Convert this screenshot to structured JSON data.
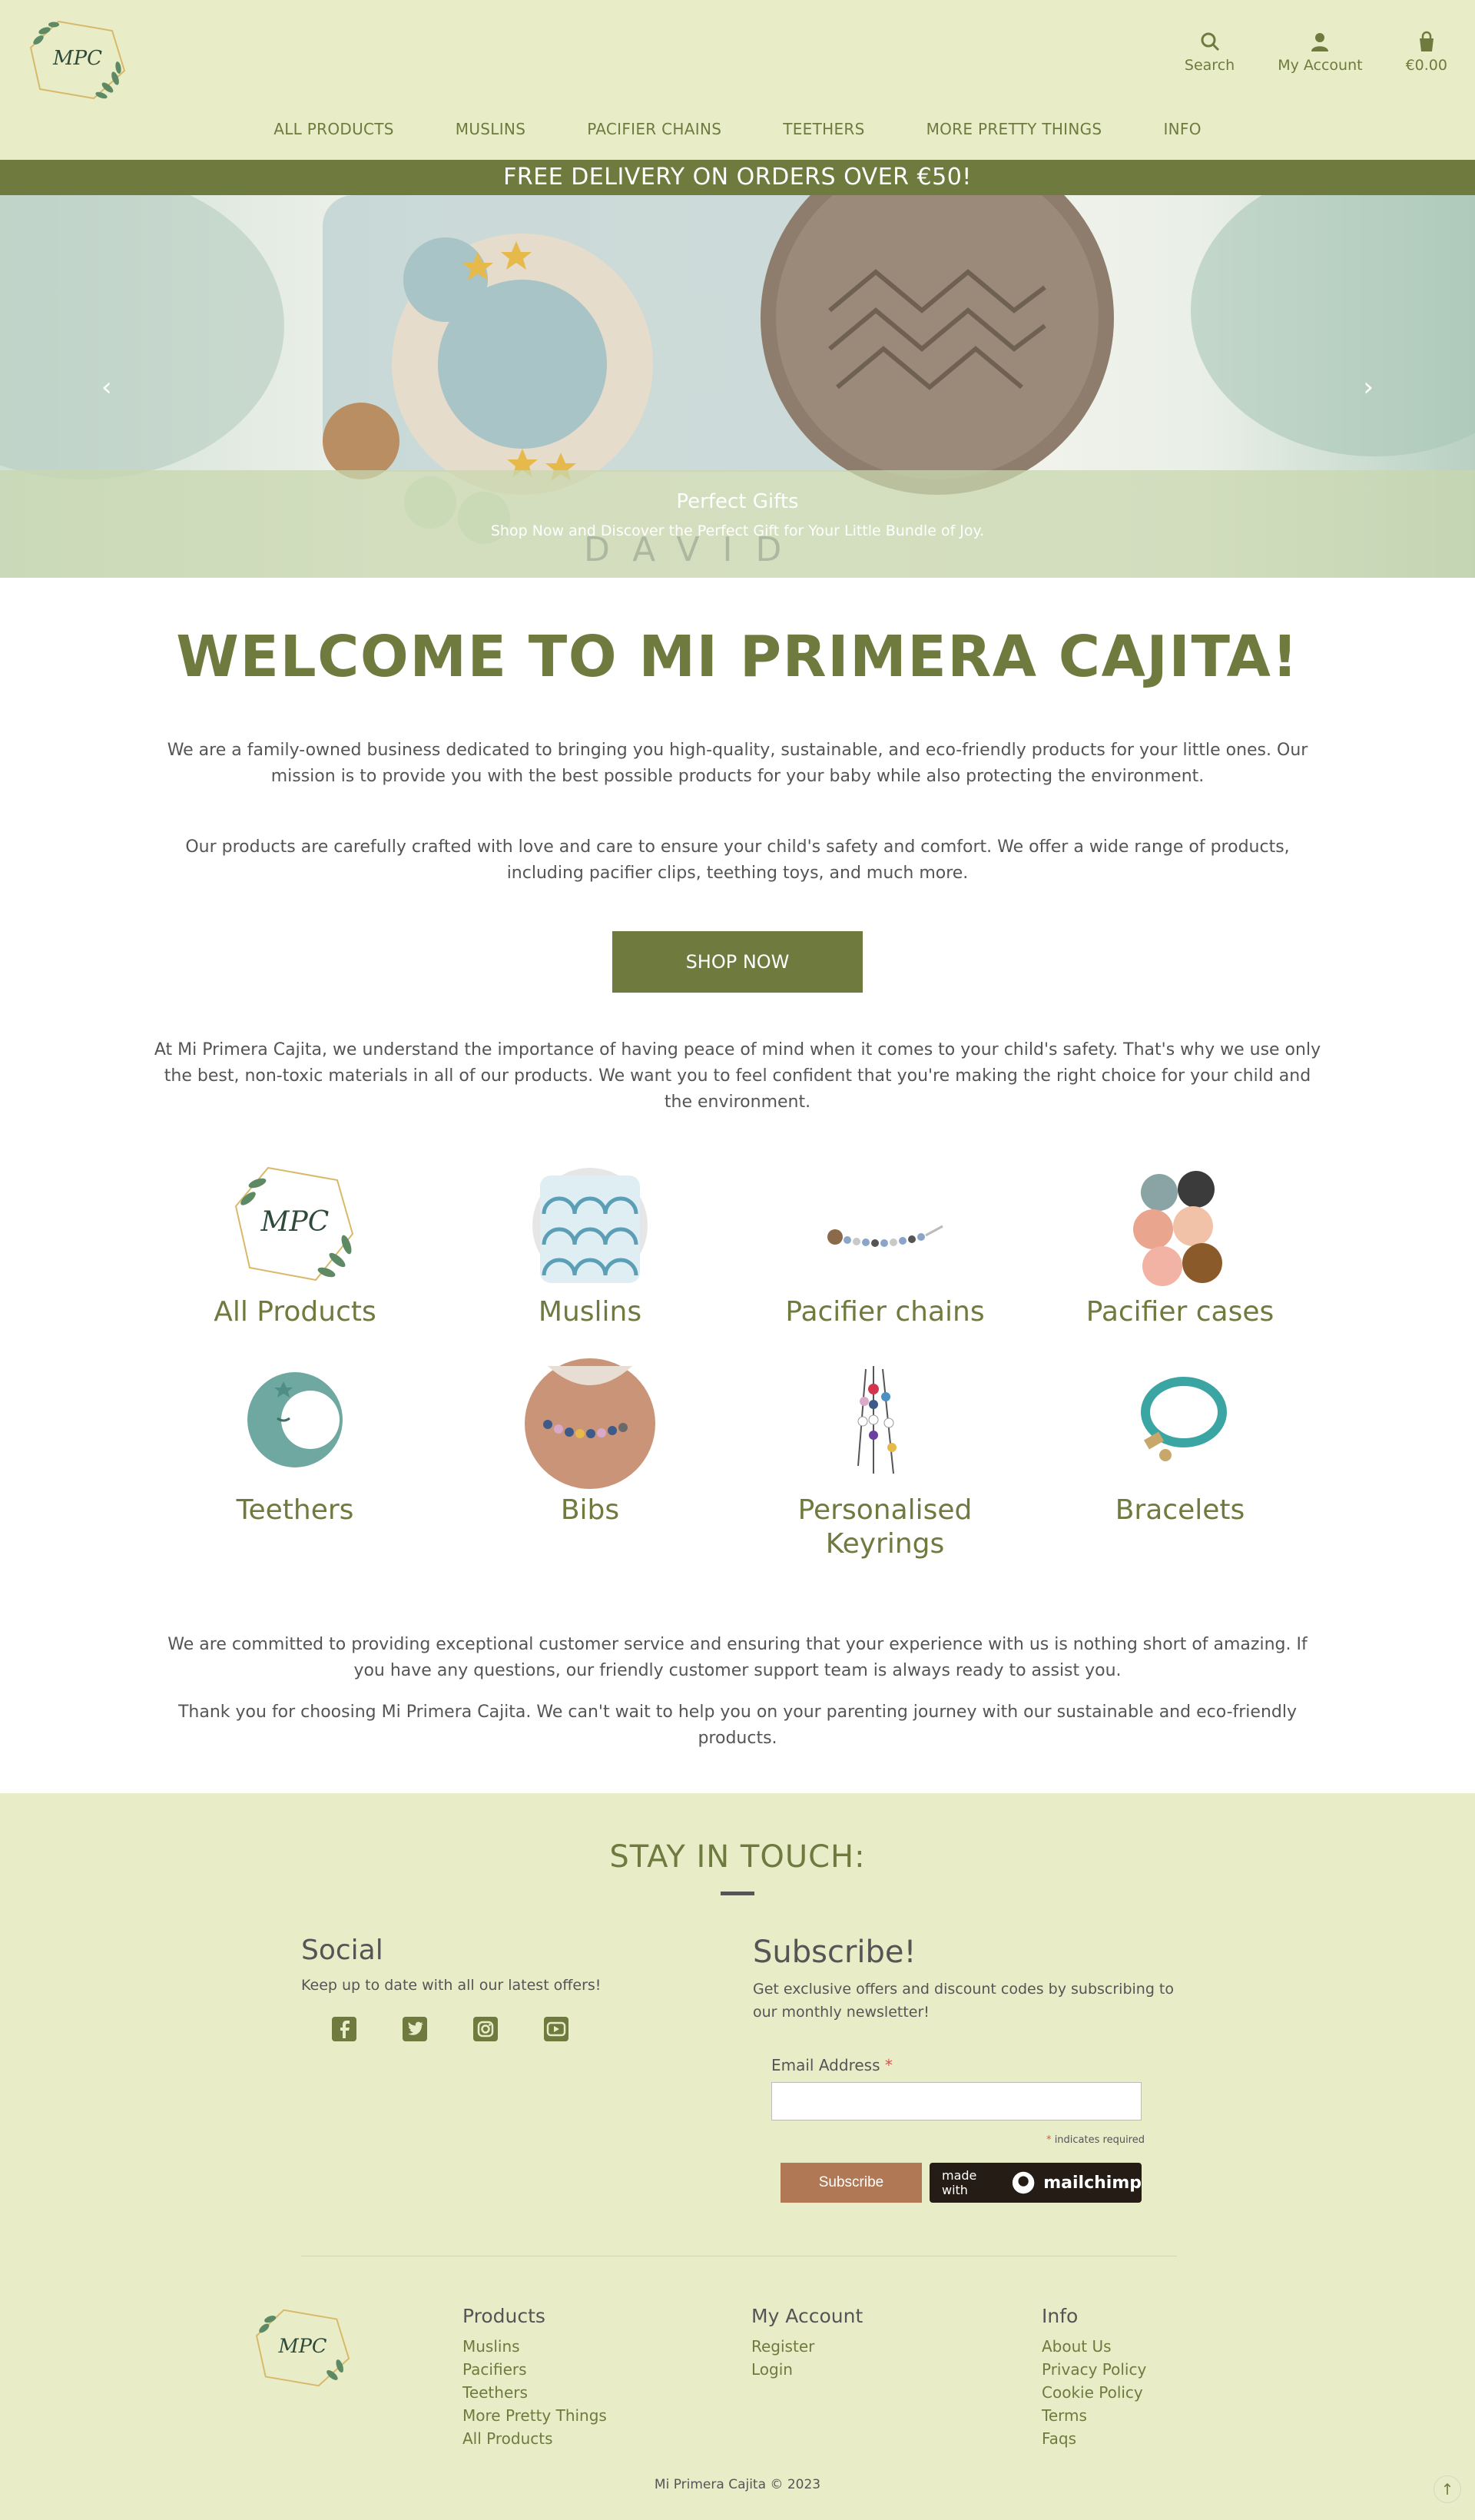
{
  "header": {
    "logo_monogram": "MPC",
    "tools": {
      "search": "Search",
      "account": "My Account",
      "cart": "€0.00"
    },
    "nav": [
      "ALL PRODUCTS",
      "MUSLINS",
      "PACIFIER CHAINS",
      "TEETHERS",
      "MORE PRETTY THINGS",
      "INFO"
    ]
  },
  "promo": "FREE DELIVERY ON ORDERS OVER €50!",
  "hero": {
    "title": "Perfect Gifts",
    "subtitle": "Shop Now and Discover the Perfect Gift for Your Little Bundle of Joy.",
    "name_beads": "DAVID"
  },
  "welcome": {
    "heading": "WELCOME TO MI PRIMERA CAJITA!",
    "p1": "We are a family-owned business dedicated to bringing you high-quality, sustainable, and eco-friendly products for your little ones. Our mission is to provide you with the best possible products for your baby while also protecting the environment.",
    "p2": "Our products are carefully crafted with love and care to ensure your child's safety and comfort. We offer a wide range of products, including pacifier clips, teething toys, and much more.",
    "shop_button": "SHOP NOW",
    "p3": "At Mi Primera Cajita, we understand the importance of having peace of mind when it comes to your child's safety. That's why we use only the best, non-toxic materials in all of our products. We want you to feel confident that you're making the right choice for your child and the environment."
  },
  "categories": [
    {
      "label": "All Products",
      "icon": "mpc-logo-icon"
    },
    {
      "label": "Muslins",
      "icon": "muslin-icon"
    },
    {
      "label": "Pacifier chains",
      "icon": "pacifier-chain-icon"
    },
    {
      "label": "Pacifier cases",
      "icon": "pacifier-case-icon"
    },
    {
      "label": "Teethers",
      "icon": "moon-teether-icon"
    },
    {
      "label": "Bibs",
      "icon": "bib-icon"
    },
    {
      "label": "Personalised Keyrings",
      "icon": "keyring-icon"
    },
    {
      "label": "Bracelets",
      "icon": "bracelet-icon"
    }
  ],
  "closing": {
    "p1": "We are committed to providing exceptional customer service and ensuring that your experience with us is nothing short of amazing. If you have any questions, our friendly customer support team is always ready to assist you.",
    "p2": "Thank you for choosing Mi Primera Cajita. We can't wait to help you on your parenting journey with our sustainable and eco-friendly products."
  },
  "footer": {
    "stay_heading": "STAY IN TOUCH:",
    "social": {
      "heading": "Social",
      "text": "Keep up to date with all our latest offers!",
      "icons": [
        "facebook-icon",
        "twitter-icon",
        "instagram-icon",
        "youtube-icon"
      ]
    },
    "subscribe": {
      "heading": "Subscribe!",
      "text": "Get exclusive offers and discount codes by subscribing to our monthly newsletter!",
      "email_label": "Email Address",
      "required_mark": "*",
      "required_note": "indicates required",
      "button": "Subscribe",
      "badge_prefix": "made with",
      "badge_brand": "mailchimp"
    },
    "columns": [
      {
        "title": "Products",
        "links": [
          "Muslins",
          "Pacifiers",
          "Teethers",
          "More Pretty Things",
          "All Products"
        ]
      },
      {
        "title": "My Account",
        "links": [
          "Register",
          "Login"
        ]
      },
      {
        "title": "Info",
        "links": [
          "About Us",
          "Privacy Policy",
          "Cookie Policy",
          "Terms",
          "Faqs"
        ]
      }
    ],
    "copyright": "Mi Primera Cajita © 2023",
    "back_to_top": "↑"
  },
  "colors": {
    "olive": "#6e7a3e",
    "footer_bg": "#e8edc8",
    "subscribe_btn": "#b07855",
    "mailchimp_bg": "#241c15"
  }
}
